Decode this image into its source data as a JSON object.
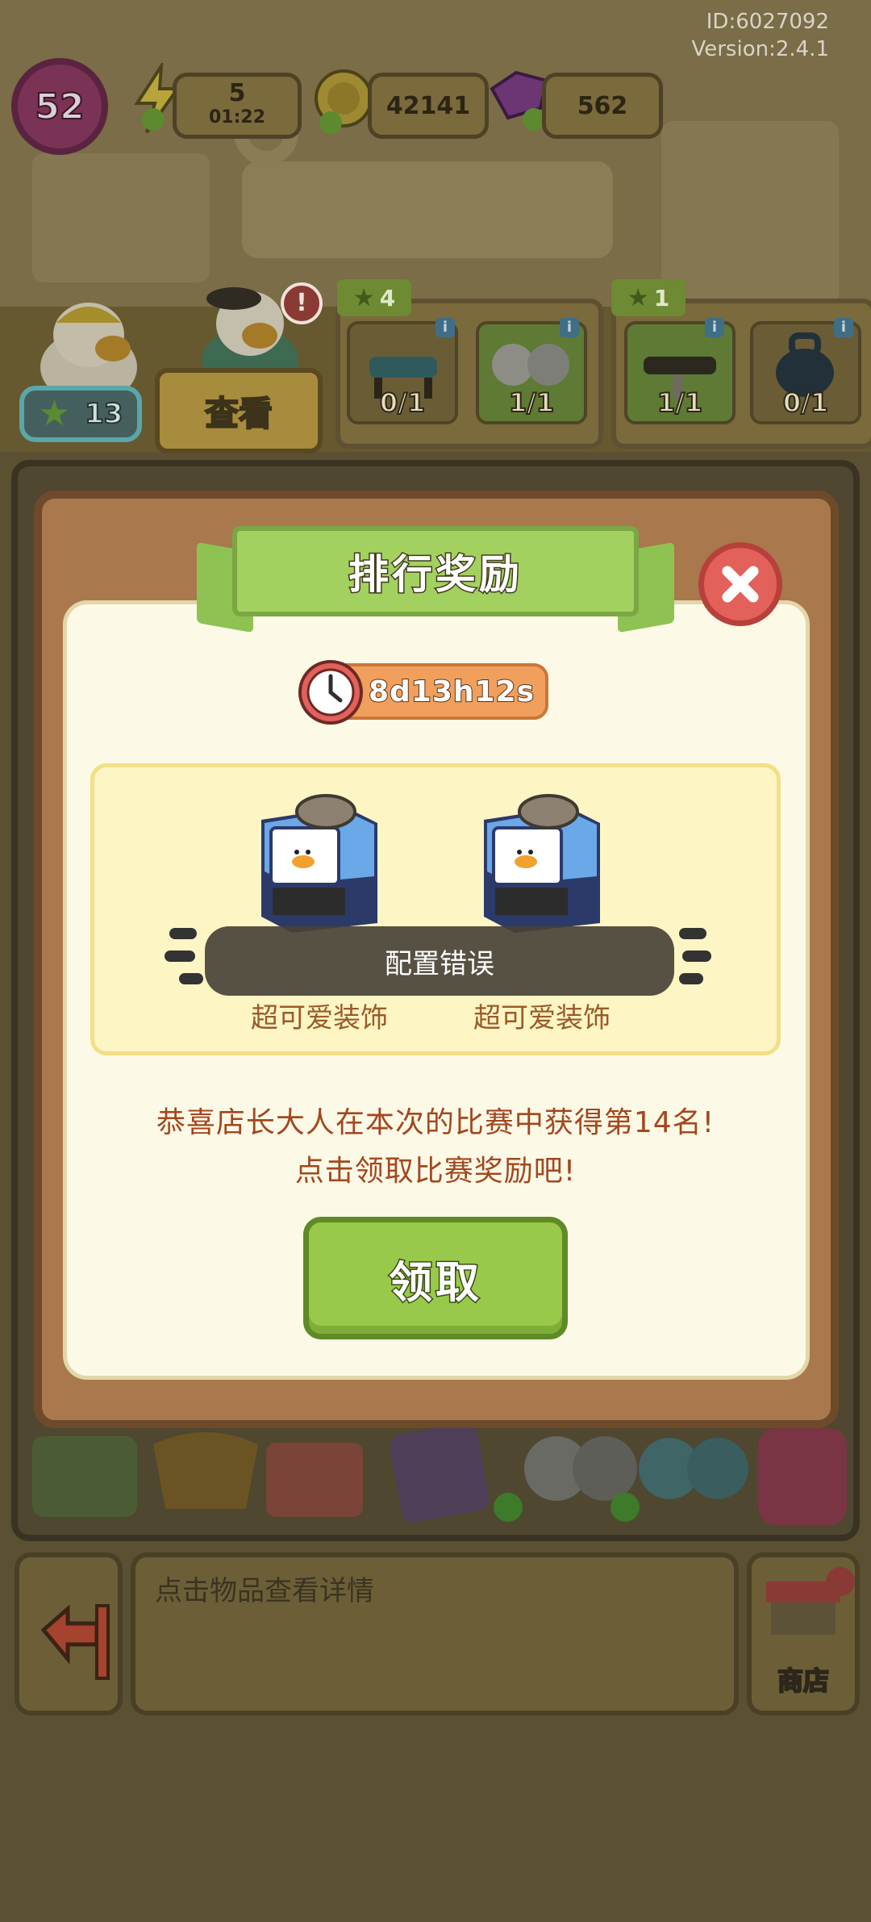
{
  "meta": {
    "id_text": "ID:6027092",
    "version_text": "Version:2.4.1"
  },
  "hud": {
    "level": "52",
    "energy": "5",
    "energy_timer": "01:22",
    "coins": "42141",
    "gems": "562"
  },
  "shop_area": {
    "star_count": "13",
    "view_button": "查看",
    "quest_cards": [
      {
        "star_count": "4",
        "slots": [
          {
            "count": "0/1",
            "done": false,
            "icon": "bench-icon"
          },
          {
            "count": "1/1",
            "done": true,
            "icon": "dumbbell-icon"
          }
        ]
      },
      {
        "star_count": "1",
        "slots": [
          {
            "count": "1/1",
            "done": true,
            "icon": "weight-machine-icon"
          },
          {
            "count": "0/1",
            "done": false,
            "icon": "kettlebell-icon"
          }
        ]
      }
    ]
  },
  "modal": {
    "title": "排行奖励",
    "timer": "8d13h12s",
    "rewards": [
      {
        "label": "超可爱装饰",
        "icon": "vending-machine-icon"
      },
      {
        "label": "超可爱装饰",
        "icon": "vending-machine-icon"
      }
    ],
    "toast": "配置错误",
    "congrats_line1": "恭喜店长大人在本次的比赛中获得第14名!",
    "congrats_line2": "点击领取比赛奖励吧!",
    "claim_button": "领取"
  },
  "bottom": {
    "hint": "点击物品查看详情",
    "shop_label": "商店"
  },
  "colors": {
    "modal_frame": "#a9784d",
    "modal_inner": "#fcf9e6",
    "ribbon_green": "#a3d160",
    "claim_green": "#98c94a",
    "close_red": "#e2615a",
    "timer_orange": "#f0a05c",
    "congrats_text": "#a3471f",
    "reward_label": "#9c5a29"
  }
}
